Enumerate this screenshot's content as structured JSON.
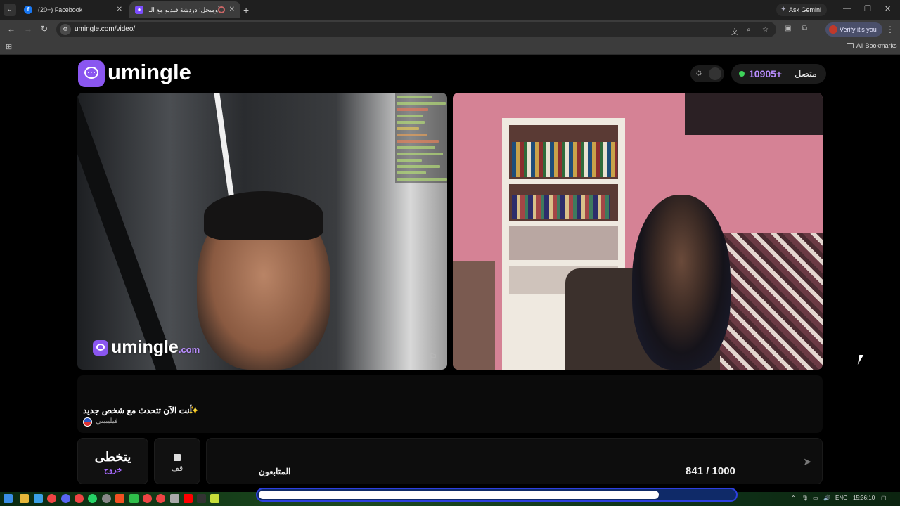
{
  "browser": {
    "tabs": [
      {
        "title": "(20+) Facebook",
        "icon": "facebook-icon"
      },
      {
        "title": "أوميجل: دردشة فيديو مع الـ",
        "icon": "umingle-icon"
      }
    ],
    "ask_gemini": "Ask Gemini",
    "url": "umingle.com/video/",
    "verify": "Verify it's you",
    "all_bookmarks": "All Bookmarks"
  },
  "site": {
    "logo_text": "umingle",
    "online_count": "10905+",
    "online_label": "متصل",
    "online_color": "#3ed35a",
    "accent": "#8a56f0"
  },
  "video": {
    "watermark": "umingle",
    "watermark_suffix": ".com"
  },
  "chat": {
    "message": "أنت الآن تتحدث مع شخص جديد",
    "country": "فيليبيني"
  },
  "controls": {
    "skip_label": "يتخطى",
    "skip_sub": "خروج",
    "stop_label": "قف",
    "followers_label": "المتابعون",
    "followers_count": "841 / 1000"
  },
  "progress": {
    "fraction": 0.84
  },
  "taskbar": {
    "lang": "ENG",
    "time": "15:36:10"
  }
}
